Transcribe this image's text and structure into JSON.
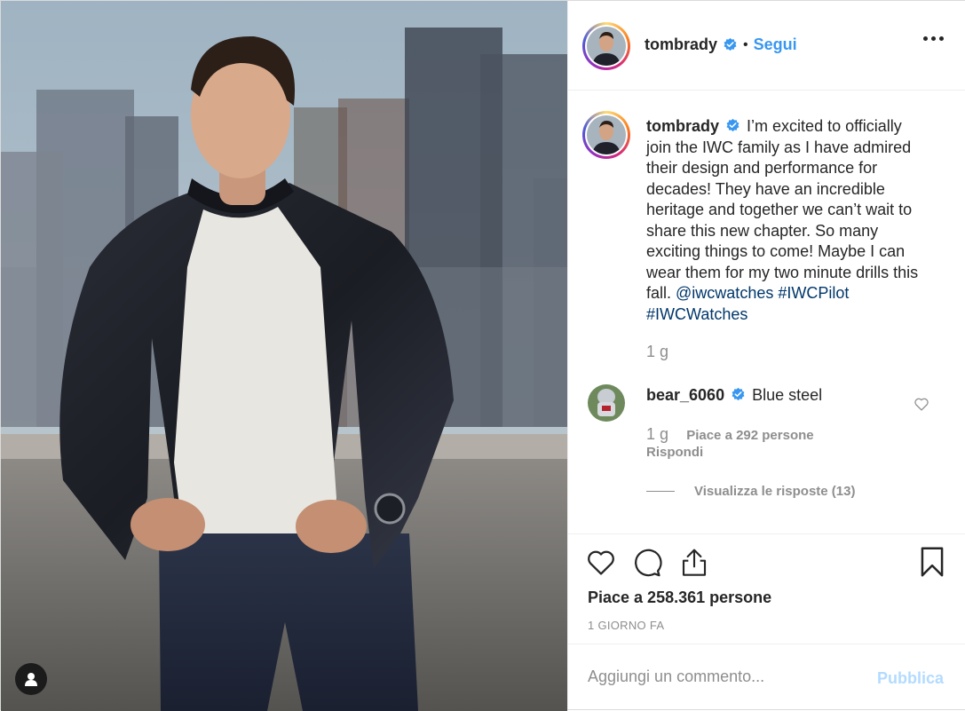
{
  "post": {
    "username": "tombrady",
    "follow_label": "Segui",
    "caption_text": "I’m excited to officially join the IWC family as I have admired their design and performance for decades! They have an incredible heritage and together we can’t wait to share this new chapter. So many exciting things to come! Maybe I can wear them for my two minute drills this fall.",
    "caption_mention": "@iwcwatches",
    "caption_tag1": "#IWCPilot",
    "caption_tag2": "#IWCWatches",
    "caption_time": "1 g",
    "likes": "Piace a 258.361 persone",
    "date": "1 GIORNO FA"
  },
  "comment": {
    "username": "bear_6060",
    "text": "Blue steel",
    "time": "1 g",
    "likes": "Piace a 292 persone",
    "reply_label": "Rispondi",
    "view_replies": "Visualizza le risposte (13)"
  },
  "add_comment": {
    "placeholder": "Aggiungi un commento...",
    "publish_label": "Pubblica"
  },
  "icons": [
    "verified-badge-icon",
    "more-options-icon",
    "heart-icon",
    "comment-icon",
    "share-icon",
    "bookmark-icon",
    "user-tag-icon"
  ],
  "colors": {
    "accent": "#3897f0",
    "link": "#00376b",
    "muted": "#8e8e8e",
    "publish_disabled": "#b3dbff",
    "verified": "#3897f0"
  }
}
